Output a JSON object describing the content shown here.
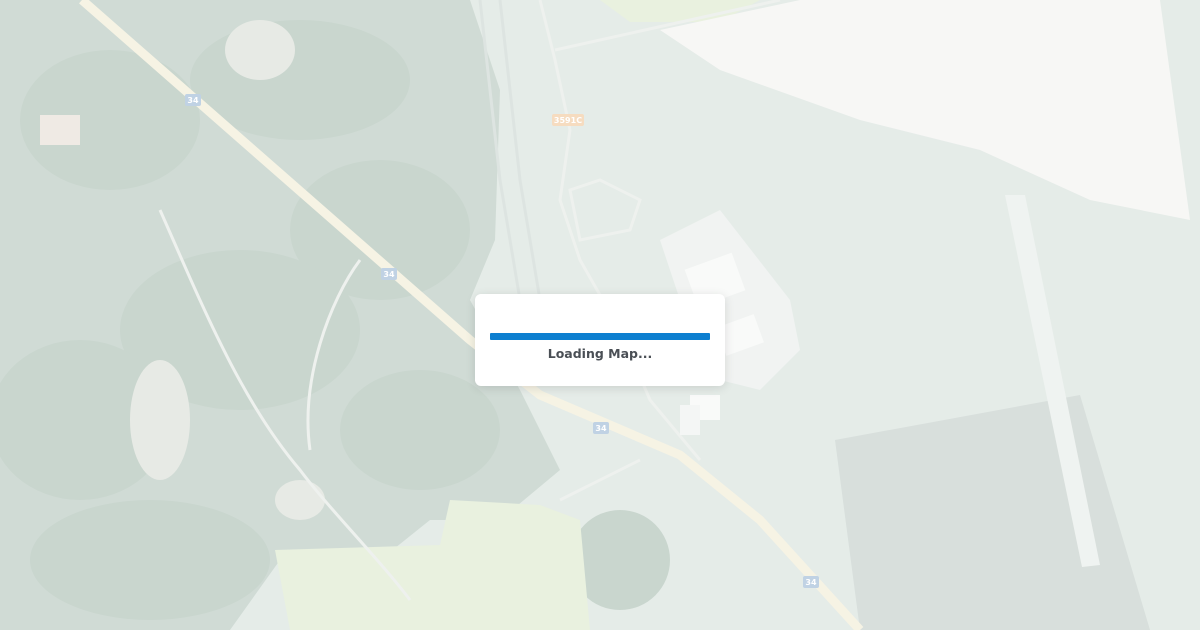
{
  "map": {
    "road_labels": {
      "highway_34_a": "34",
      "highway_34_b": "34",
      "highway_34_c": "34",
      "highway_34_d": "34",
      "road_3591c": "3591C"
    }
  },
  "loader": {
    "text": "Loading Map...",
    "progress_percent": 100,
    "bar_color": "#0d7fd0"
  }
}
